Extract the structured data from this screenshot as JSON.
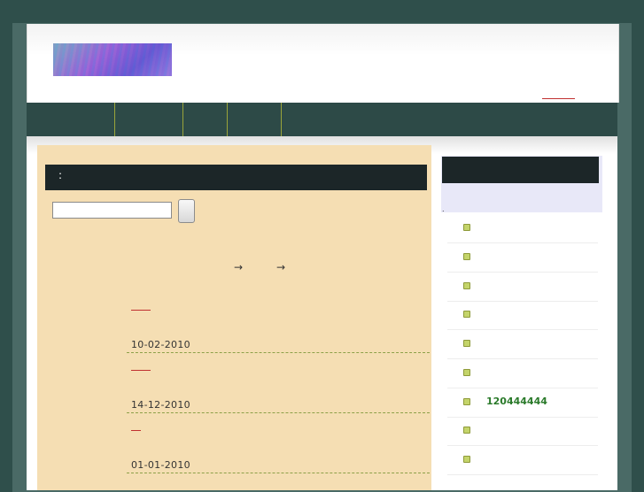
{
  "main": {
    "title": ":",
    "search": {
      "value": "",
      "placeholder": ""
    },
    "search_button_label": "",
    "pager": {
      "arrow_1": "→",
      "arrow_2": "→"
    },
    "posts": [
      {
        "title": "",
        "date": "10-02-2010"
      },
      {
        "title": "",
        "date": "14-12-2010"
      },
      {
        "title": "",
        "date": "01-01-2010"
      }
    ]
  },
  "sidebar": {
    "title": "",
    "mark": ".",
    "items": [
      {
        "label": ""
      },
      {
        "label": ""
      },
      {
        "label": ""
      },
      {
        "label": ""
      },
      {
        "label": ""
      },
      {
        "label": ""
      },
      {
        "label": "120444444"
      },
      {
        "label": ""
      },
      {
        "label": ""
      }
    ]
  },
  "colors": {
    "background": "#2f4f4b",
    "navbar": "#2d4a47",
    "main_panel": "#f5deb3",
    "title_bar": "#1c2628",
    "link_underline": "#c03030",
    "accent_green": "#2a7a2a"
  }
}
